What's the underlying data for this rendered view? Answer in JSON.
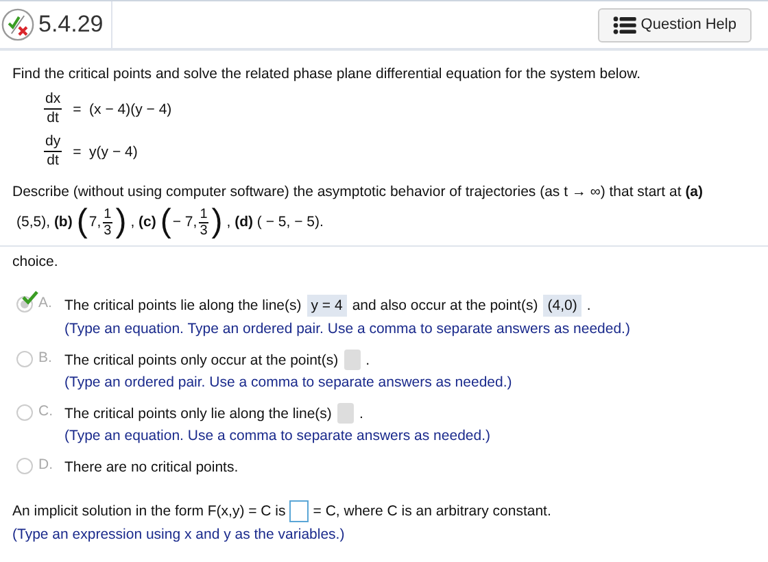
{
  "header": {
    "number": "5.4.29",
    "help": "Question Help"
  },
  "question": "Find the critical points and solve the related phase plane differential equation for the system below.",
  "equations": [
    {
      "numerator": "dx",
      "denominator": "dt",
      "rhs": "=  (x − 4)(y − 4)"
    },
    {
      "numerator": "dy",
      "denominator": "dt",
      "rhs": "=  y(y − 4)"
    }
  ],
  "describe": "Describe (without using computer software) the asymptotic behavior of trajectories (as t → ∞) that start at **(a)**",
  "points": [
    {
      "kind": "text",
      "text": "(5,5), **(b)**"
    },
    {
      "kind": "pair",
      "open": "(",
      "first": "7,",
      "num": "1",
      "den": "3",
      "close": ")"
    },
    {
      "kind": "text",
      "text": ", **(c)**"
    },
    {
      "kind": "pair",
      "open": "(",
      "first": "− 7,",
      "num": "1",
      "den": "3",
      "close": ")"
    },
    {
      "kind": "text",
      "text": ", **(d)** ( − 5, − 5)."
    }
  ],
  "choice_text": "choice.",
  "options": [
    {
      "letter": "A.",
      "selected": true,
      "parts": [
        {
          "kind": "text",
          "text": "The critical points lie along the line(s)"
        },
        {
          "kind": "answer",
          "value": "y = 4"
        },
        {
          "kind": "text",
          "text": "and also occur at the point(s)"
        },
        {
          "kind": "answer",
          "value": "(4,0)"
        },
        {
          "kind": "text",
          "text": "."
        }
      ],
      "hint": "(Type an equation. Type an ordered pair. Use a comma to separate answers as needed.)"
    },
    {
      "letter": "B.",
      "selected": false,
      "parts": [
        {
          "kind": "text",
          "text": "The critical points only occur at the point(s)"
        },
        {
          "kind": "answer"
        },
        {
          "kind": "text",
          "text": "."
        }
      ],
      "hint": "(Type an ordered pair. Use a comma to separate answers as needed.)"
    },
    {
      "letter": "C.",
      "selected": false,
      "parts": [
        {
          "kind": "text",
          "text": "The critical points only lie along the line(s)"
        },
        {
          "kind": "answer"
        },
        {
          "kind": "text",
          "text": "."
        }
      ],
      "hint": "(Type an equation. Use a comma to separate answers as needed.)"
    },
    {
      "letter": "D.",
      "selected": false,
      "parts": [
        {
          "kind": "text",
          "text": "There are no critical points."
        }
      ]
    }
  ],
  "implicit": {
    "before": "An implicit solution in the form F(x,y) = C is",
    "after": "= C, where C is an arbitrary constant.",
    "hint": "(Type an expression using x and y as the variables.)"
  }
}
